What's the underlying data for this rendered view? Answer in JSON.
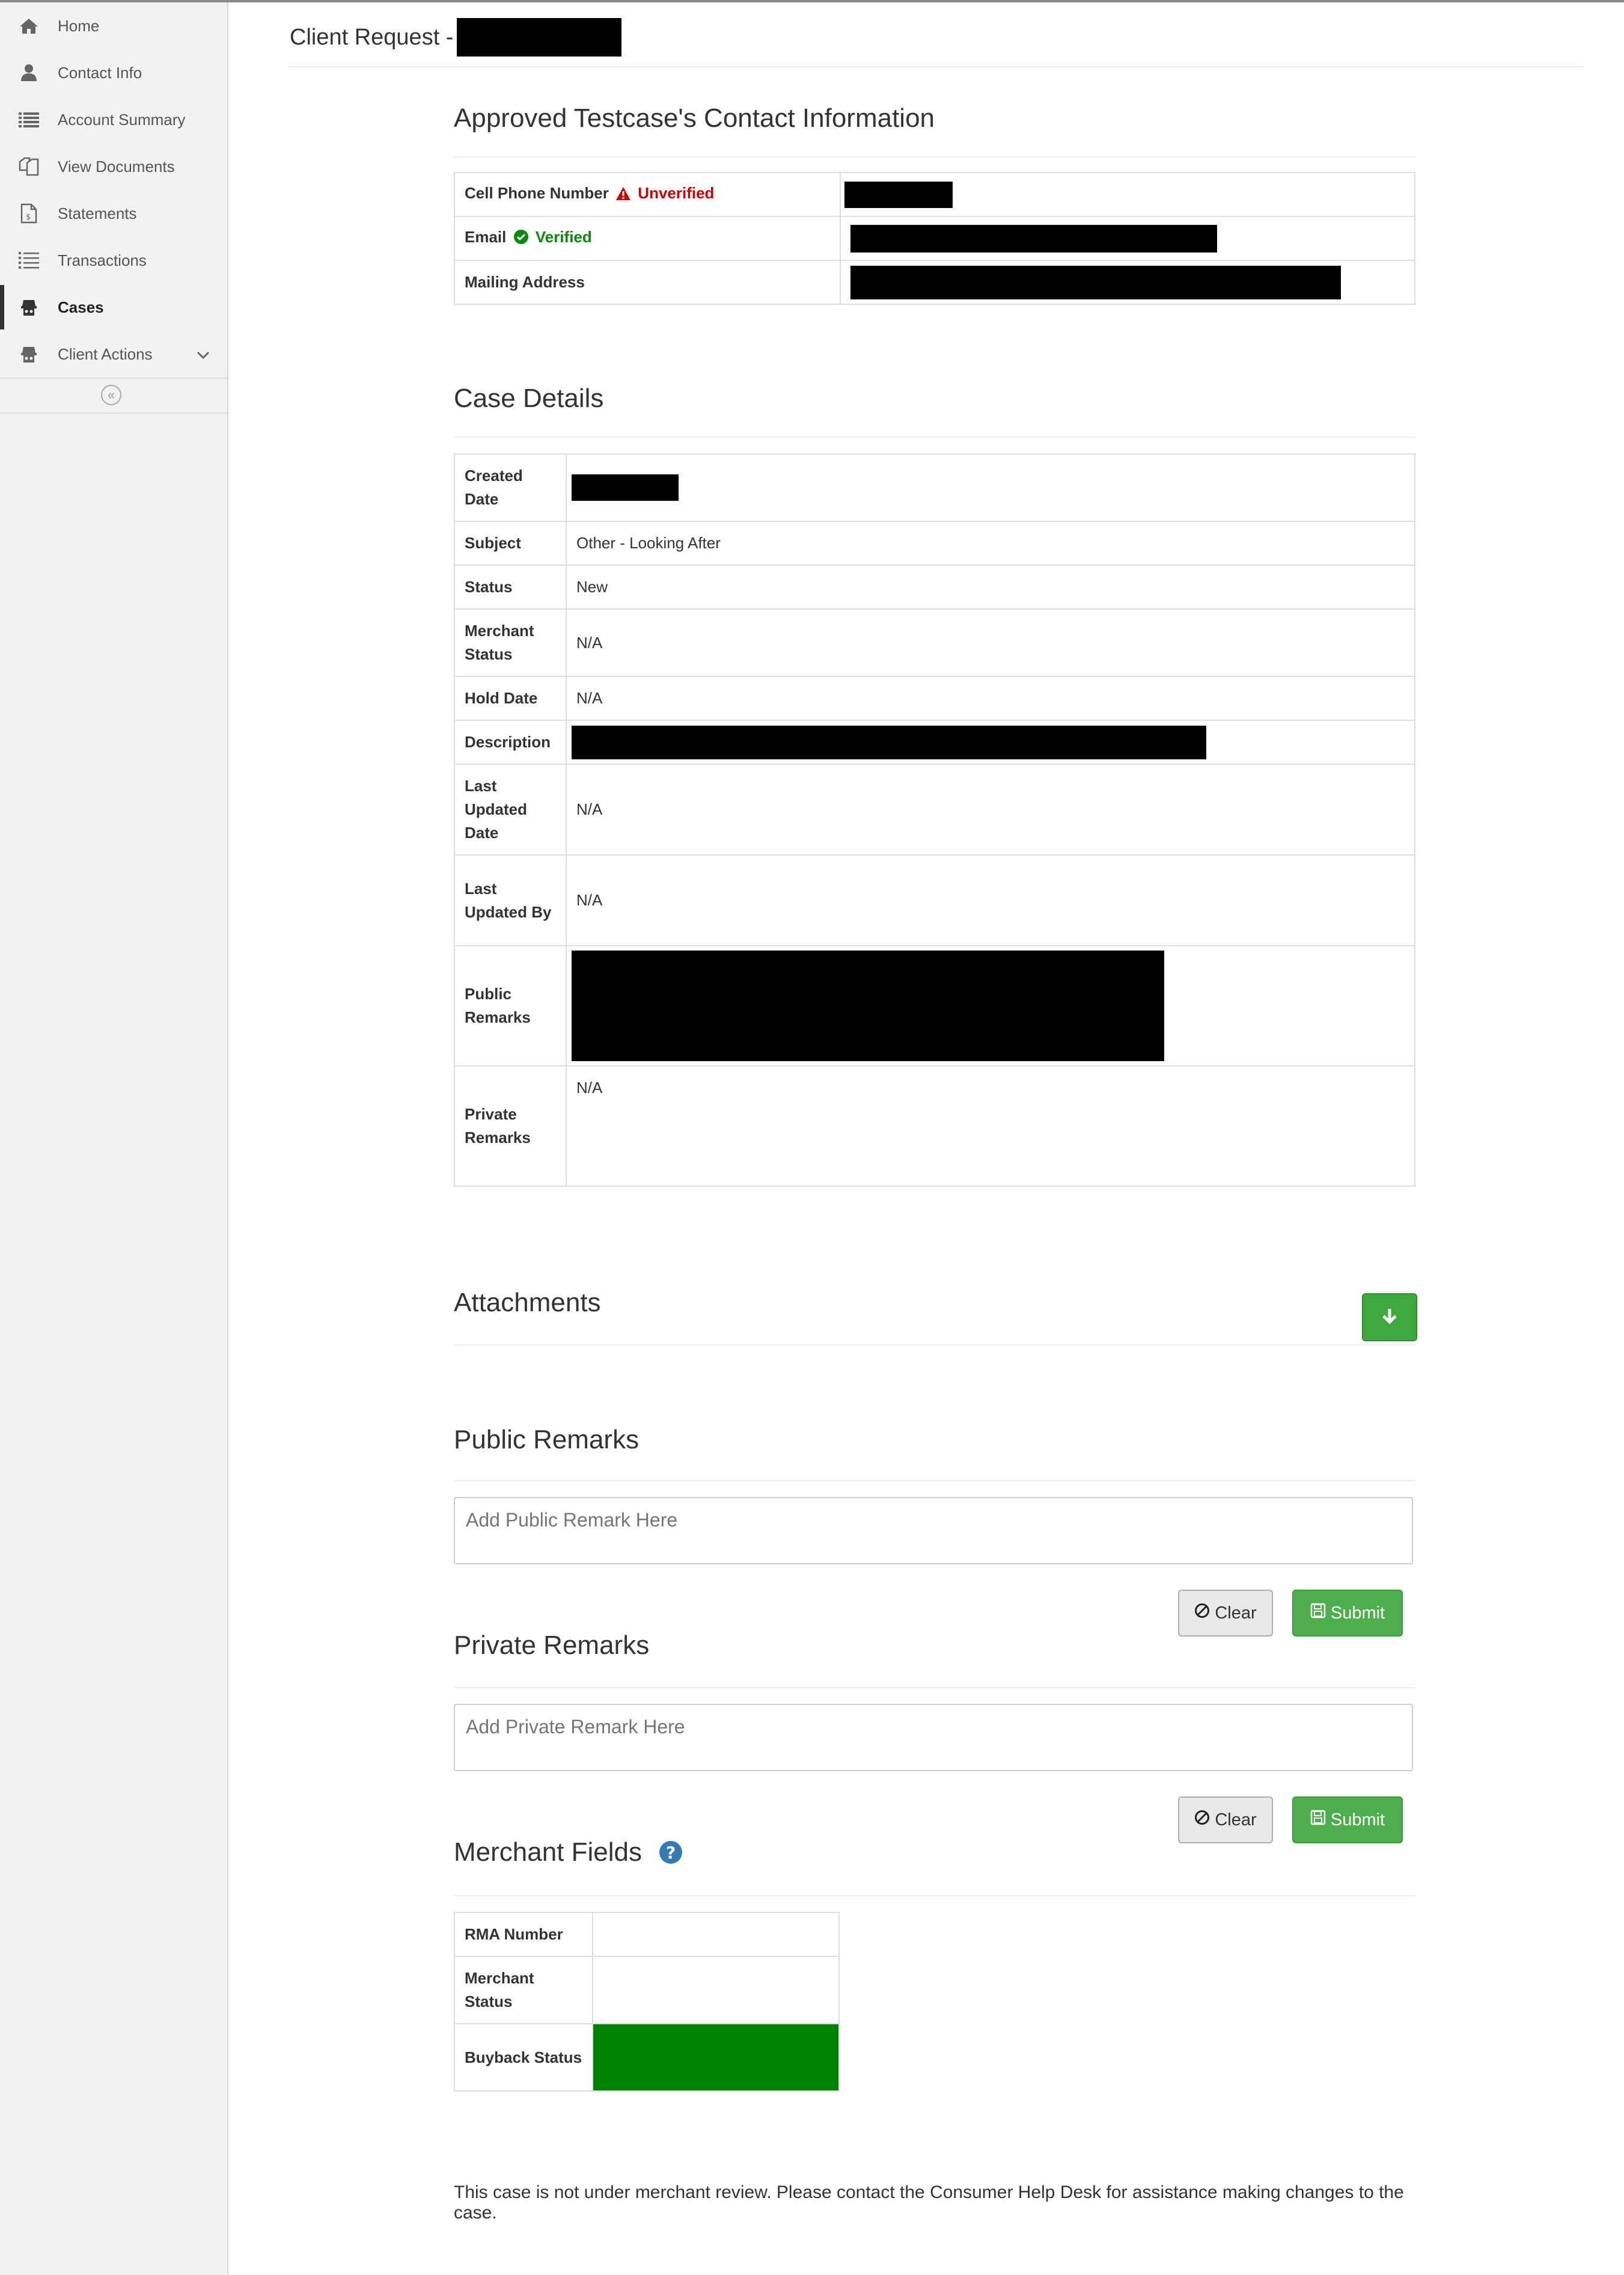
{
  "sidebar": {
    "items": [
      {
        "label": "Home",
        "icon": "home-icon"
      },
      {
        "label": "Contact Info",
        "icon": "user-icon"
      },
      {
        "label": "Account Summary",
        "icon": "list-icon"
      },
      {
        "label": "View Documents",
        "icon": "documents-icon"
      },
      {
        "label": "Statements",
        "icon": "statement-icon"
      },
      {
        "label": "Transactions",
        "icon": "transactions-icon"
      },
      {
        "label": "Cases",
        "icon": "cases-icon",
        "active": true
      },
      {
        "label": "Client Actions",
        "icon": "client-actions-icon",
        "has_submenu": true
      }
    ],
    "collapse_glyph": "«"
  },
  "header": {
    "title": "Client Request -"
  },
  "contact": {
    "title": "Approved Testcase's Contact Information",
    "rows": [
      {
        "label": "Cell Phone Number",
        "badge": "Unverified",
        "badge_color": "#d00000"
      },
      {
        "label": "Email",
        "badge": "Verified",
        "badge_color": "#0a8a0a"
      },
      {
        "label": "Mailing Address"
      }
    ]
  },
  "case": {
    "title": "Case Details",
    "labels": {
      "created": "Created Date",
      "subject": "Subject",
      "status": "Status",
      "merchant_status": "Merchant Status",
      "hold_date": "Hold Date",
      "description": "Description",
      "last_updated_date": "Last Updated Date",
      "last_updated_by": "Last Updated By",
      "public_remarks": "Public Remarks",
      "private_remarks": "Private Remarks"
    },
    "values": {
      "subject": "Other - Looking After",
      "status": "New",
      "merchant_status": "N/A",
      "hold_date": "N/A",
      "last_updated_date": "N/A",
      "last_updated_by": "N/A",
      "private_remarks": "N/A"
    }
  },
  "attachments": {
    "title": "Attachments"
  },
  "public_remarks": {
    "title": "Public Remarks",
    "placeholder": "Add Public Remark Here",
    "clear_label": "Clear",
    "submit_label": "Submit"
  },
  "private_remarks": {
    "title": "Private Remarks",
    "placeholder": "Add Private Remark Here",
    "clear_label": "Clear",
    "submit_label": "Submit"
  },
  "merchant": {
    "title": "Merchant Fields",
    "labels": {
      "rma": "RMA Number",
      "merchant_status": "Merchant Status",
      "buyback_status": "Buyback Status"
    },
    "buyback_color": "#008000"
  },
  "footer": {
    "note": "This case is not under merchant review. Please contact the Consumer Help Desk for assistance making changes to the case."
  },
  "colors": {
    "accent_green": "#4cae4c",
    "help_blue": "#337ab7"
  }
}
